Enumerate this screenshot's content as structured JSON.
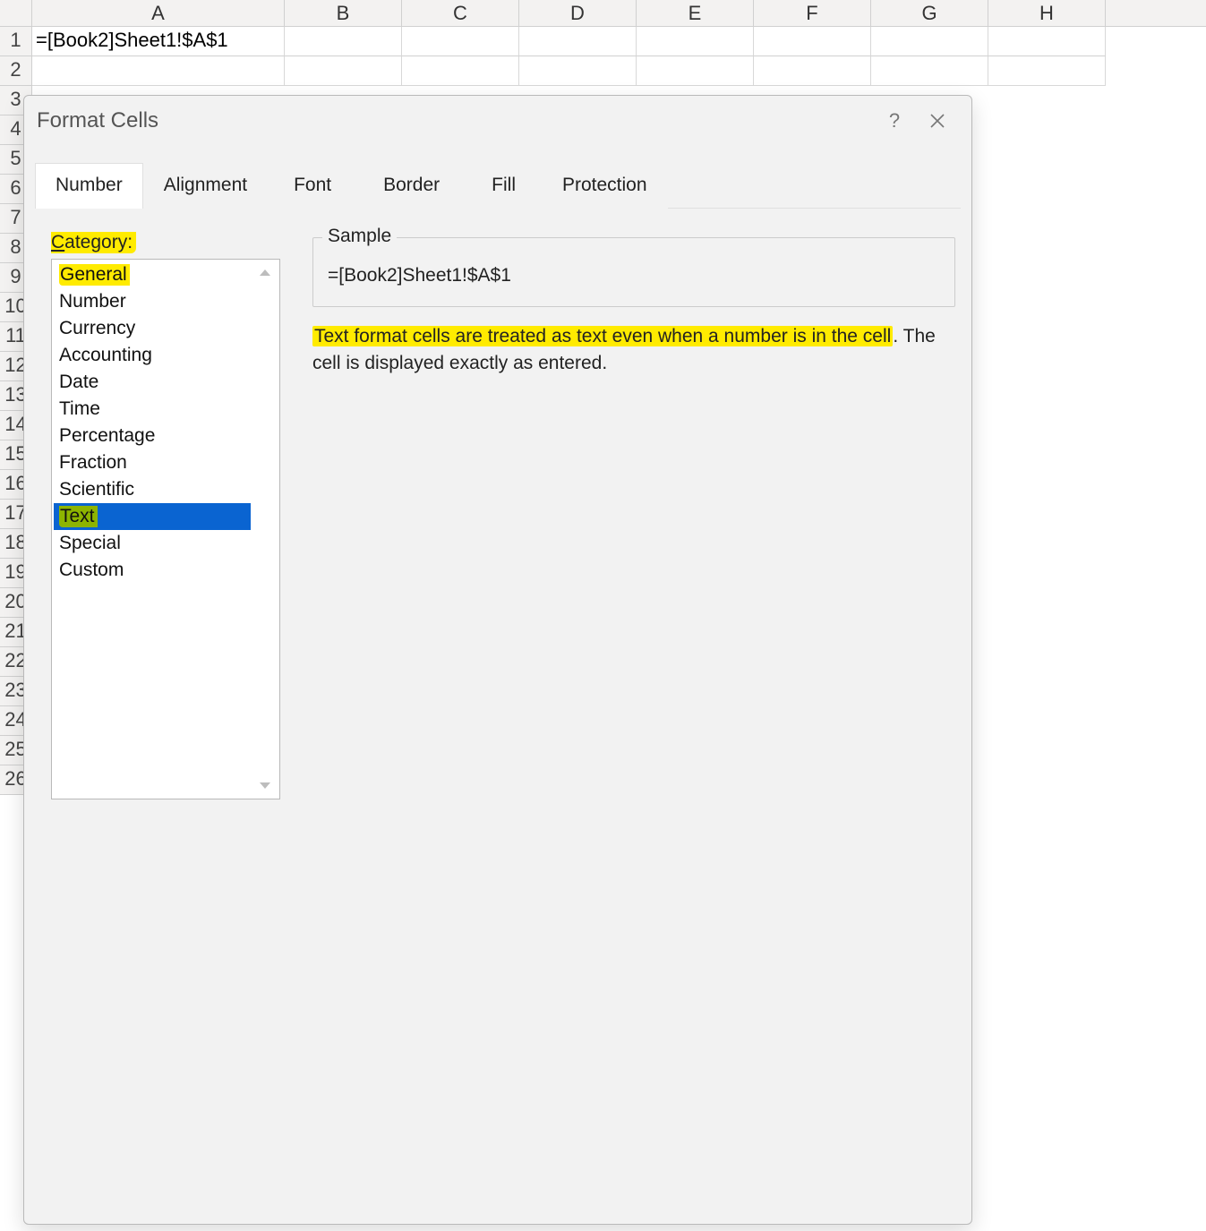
{
  "sheet": {
    "columns": [
      "A",
      "B",
      "C",
      "D",
      "E",
      "F",
      "G",
      "H"
    ],
    "rows": [
      1,
      2,
      3,
      4,
      5,
      6,
      7,
      8,
      9,
      10,
      11,
      12,
      13,
      14,
      15,
      16,
      17,
      18,
      19,
      20,
      21,
      22,
      23,
      24,
      25,
      26
    ],
    "cells": {
      "A1": "=[Book2]Sheet1!$A$1"
    }
  },
  "dialog": {
    "title": "Format Cells",
    "help_symbol": "?",
    "tabs": [
      "Number",
      "Alignment",
      "Font",
      "Border",
      "Fill",
      "Protection"
    ],
    "active_tab": "Number",
    "category_label_underline": "C",
    "category_label_rest": "ategory:",
    "categories": [
      "General",
      "Number",
      "Currency",
      "Accounting",
      "Date",
      "Time",
      "Percentage",
      "Fraction",
      "Scientific",
      "Text",
      "Special",
      "Custom"
    ],
    "selected_category": "Text",
    "highlighted_categories": [
      "General",
      "Text"
    ],
    "sample_label": "Sample",
    "sample_value": "=[Book2]Sheet1!$A$1",
    "description_highlight": "Text format cells are treated as text even when a number is in the cell",
    "description_dot": ".",
    "description_rest": " The cell is displayed exactly as entered."
  }
}
